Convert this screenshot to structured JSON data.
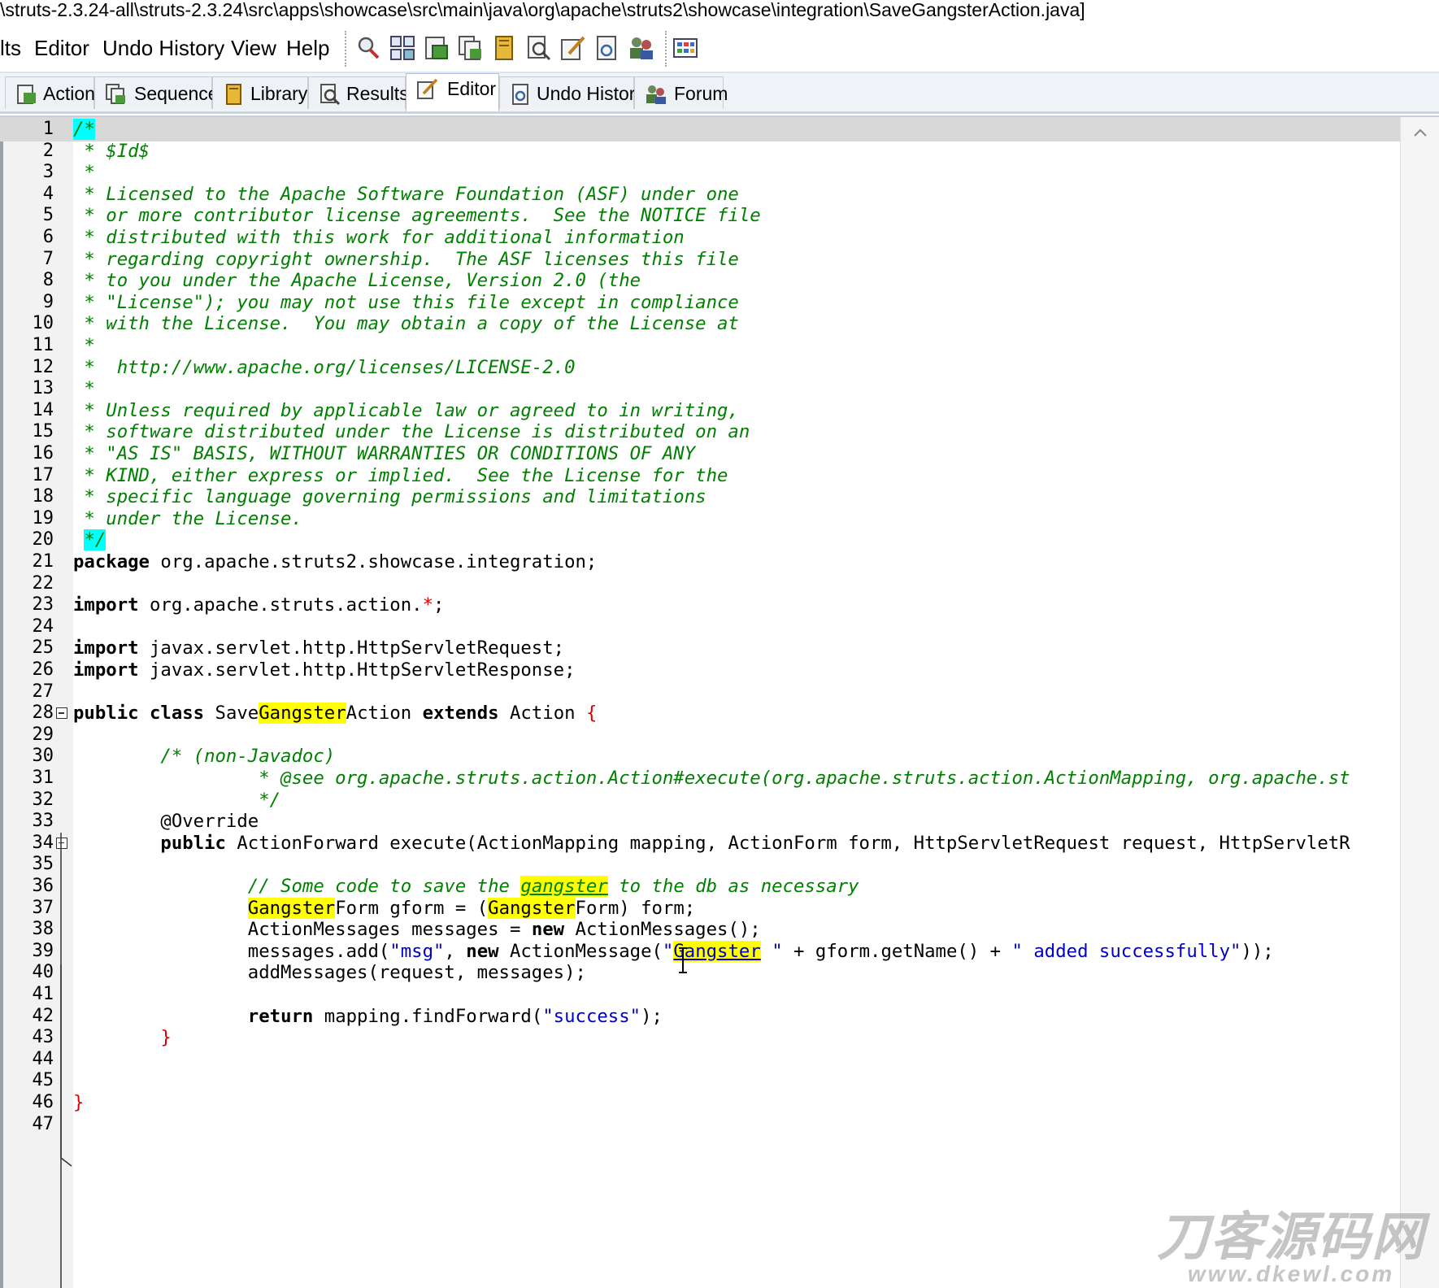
{
  "window": {
    "title": "\\struts-2.3.24-all\\struts-2.3.24\\src\\apps\\showcase\\src\\main\\java\\org\\apache\\struts2\\showcase\\integration\\SaveGangsterAction.java]"
  },
  "menu": {
    "items": [
      "lts",
      "Editor",
      "Undo History",
      "View",
      "Help"
    ]
  },
  "toolbar": {
    "icons": [
      "search-icon",
      "grid-icon",
      "action-icon",
      "sequence-icon",
      "library-icon",
      "results-icon",
      "edit-icon",
      "undo-history-icon",
      "forum-users-icon",
      "table-icon"
    ]
  },
  "tabs": [
    {
      "label": "Action",
      "icon": "action-icon"
    },
    {
      "label": "Sequence",
      "icon": "sequence-icon"
    },
    {
      "label": "Library",
      "icon": "library-icon"
    },
    {
      "label": "Results",
      "icon": "results-icon"
    },
    {
      "label": "Editor",
      "icon": "edit-icon",
      "active": true
    },
    {
      "label": "Undo History",
      "icon": "undo-history-icon"
    },
    {
      "label": "Forum",
      "icon": "forum-users-icon"
    }
  ],
  "editor": {
    "current_line": 1,
    "fold_lines": [
      28,
      34
    ],
    "lines": [
      [
        [
          "/*",
          "c hlc"
        ]
      ],
      [
        [
          " * $Id$",
          "c"
        ]
      ],
      [
        [
          " *",
          "c"
        ]
      ],
      [
        [
          " * Licensed to the Apache Software Foundation (ASF) under one",
          "c"
        ]
      ],
      [
        [
          " * or more contributor license agreements.  See the NOTICE file",
          "c"
        ]
      ],
      [
        [
          " * distributed with this work for additional information",
          "c"
        ]
      ],
      [
        [
          " * regarding copyright ownership.  The ASF licenses this file",
          "c"
        ]
      ],
      [
        [
          " * to you under the Apache License, Version 2.0 (the",
          "c"
        ]
      ],
      [
        [
          " * \"License\"); you may not use this file except in compliance",
          "c"
        ]
      ],
      [
        [
          " * with the License.  You may obtain a copy of the License at",
          "c"
        ]
      ],
      [
        [
          " *",
          "c"
        ]
      ],
      [
        [
          " *  http://www.apache.org/licenses/LICENSE-2.0",
          "c"
        ]
      ],
      [
        [
          " *",
          "c"
        ]
      ],
      [
        [
          " * Unless required by applicable law or agreed to in writing,",
          "c"
        ]
      ],
      [
        [
          " * software distributed under the License is distributed on an",
          "c"
        ]
      ],
      [
        [
          " * \"AS IS\" BASIS, WITHOUT WARRANTIES OR CONDITIONS OF ANY",
          "c"
        ]
      ],
      [
        [
          " * KIND, either express or implied.  See the License for the",
          "c"
        ]
      ],
      [
        [
          " * specific language governing permissions and limitations",
          "c"
        ]
      ],
      [
        [
          " * under the License.",
          "c"
        ]
      ],
      [
        [
          " ",
          ""
        ],
        [
          "*/",
          "c hlc"
        ]
      ],
      [
        [
          "package",
          "k"
        ],
        [
          " org.apache.struts2.showcase.integration;",
          ""
        ]
      ],
      [],
      [
        [
          "import",
          "k"
        ],
        [
          " org.apache.struts.action.",
          ""
        ],
        [
          "*",
          "p"
        ],
        [
          ";",
          ""
        ]
      ],
      [],
      [
        [
          "import",
          "k"
        ],
        [
          " javax.servlet.http.HttpServletRequest;",
          ""
        ]
      ],
      [
        [
          "import",
          "k"
        ],
        [
          " javax.servlet.http.HttpServletResponse;",
          ""
        ]
      ],
      [],
      [
        [
          "public",
          "k"
        ],
        [
          " ",
          ""
        ],
        [
          "class",
          "k"
        ],
        [
          " Save",
          ""
        ],
        [
          "Gangster",
          "hl"
        ],
        [
          "Action ",
          ""
        ],
        [
          "extends",
          "k"
        ],
        [
          " Action ",
          ""
        ],
        [
          "{",
          "p"
        ]
      ],
      [],
      [
        [
          "        /* (non-Javadoc)",
          "c"
        ]
      ],
      [
        [
          "                 * @see org.apache.struts.action.Action#execute(org.apache.struts.action.ActionMapping, org.apache.st",
          "c"
        ]
      ],
      [
        [
          "                 */",
          "c"
        ]
      ],
      [
        [
          "        @Override",
          ""
        ]
      ],
      [
        [
          "        ",
          ""
        ],
        [
          "public",
          "k"
        ],
        [
          " ActionForward execute(ActionMapping mapping, ActionForm form, HttpServletRequest request, HttpServletR",
          ""
        ]
      ],
      [],
      [
        [
          "                // Some code to save the ",
          "c"
        ],
        [
          "gangster",
          "c hl u"
        ],
        [
          " to the db as necessary",
          "c"
        ]
      ],
      [
        [
          "                ",
          ""
        ],
        [
          "Gangster",
          "hl"
        ],
        [
          "Form gform = (",
          ""
        ],
        [
          "Gangster",
          "hl"
        ],
        [
          "Form) form;",
          ""
        ]
      ],
      [
        [
          "                ActionMessages messages = ",
          ""
        ],
        [
          "new",
          "k"
        ],
        [
          " ActionMessages();",
          ""
        ]
      ],
      [
        [
          "                messages.add(",
          ""
        ],
        [
          "\"msg\"",
          "s"
        ],
        [
          ", ",
          ""
        ],
        [
          "new",
          "k"
        ],
        [
          " ActionMessage(",
          ""
        ],
        [
          "\"",
          "s"
        ],
        [
          "Gangster",
          "s hl u"
        ],
        [
          " \"",
          "s"
        ],
        [
          " + gform.getName() + ",
          ""
        ],
        [
          "\" added successfully\"",
          "s"
        ],
        [
          "));",
          ""
        ]
      ],
      [
        [
          "                addMessages(request, messages);",
          ""
        ]
      ],
      [],
      [
        [
          "                ",
          ""
        ],
        [
          "return",
          "k"
        ],
        [
          " mapping.findForward(",
          ""
        ],
        [
          "\"success\"",
          "s"
        ],
        [
          ");",
          ""
        ]
      ],
      [
        [
          "        ",
          ""
        ],
        [
          "}",
          "p"
        ]
      ],
      [],
      [],
      [
        [
          "}",
          "p"
        ]
      ],
      []
    ]
  },
  "watermark": {
    "line1": "刀客源码网",
    "line2": "www.dkewl.com"
  },
  "colors": {
    "comment": "#008000",
    "string": "#0000c8",
    "punct": "#e00000",
    "highlight": "#ffff00",
    "comment_marker": "#00ffff"
  }
}
